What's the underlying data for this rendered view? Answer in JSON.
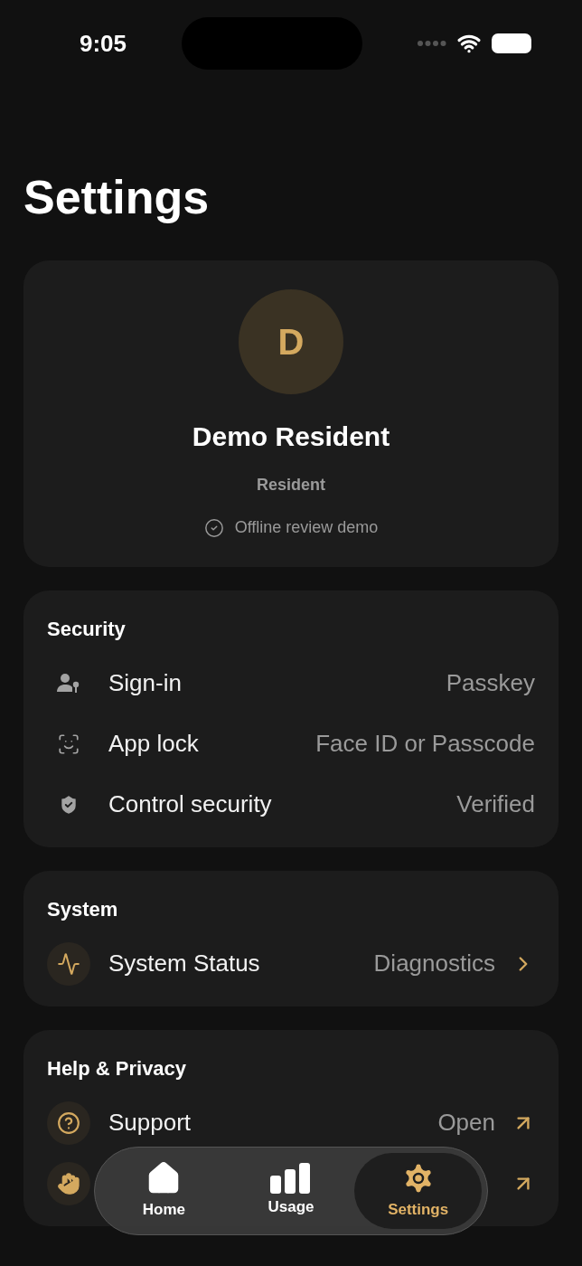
{
  "status_bar": {
    "time": "9:05"
  },
  "title": "Settings",
  "profile": {
    "initial": "D",
    "name": "Demo Resident",
    "role": "Resident",
    "status": "Offline review demo"
  },
  "sections": [
    {
      "title": "Security",
      "rows": [
        {
          "kind": "info",
          "label": "Sign-in",
          "value": "Passkey"
        },
        {
          "kind": "info",
          "label": "App lock",
          "value": "Face ID or Passcode"
        },
        {
          "kind": "info",
          "label": "Control security",
          "value": "Verified"
        }
      ]
    },
    {
      "title": "System",
      "rows": [
        {
          "kind": "navigate",
          "label": "System Status",
          "value": "Diagnostics"
        }
      ]
    },
    {
      "title": "Help & Privacy",
      "rows": [
        {
          "kind": "external",
          "label": "Support",
          "value": "Open"
        },
        {
          "kind": "external"
        }
      ]
    }
  ],
  "tabs": [
    {
      "label": "Home",
      "selected": false
    },
    {
      "label": "Usage",
      "selected": false
    },
    {
      "label": "Settings",
      "selected": true
    }
  ]
}
